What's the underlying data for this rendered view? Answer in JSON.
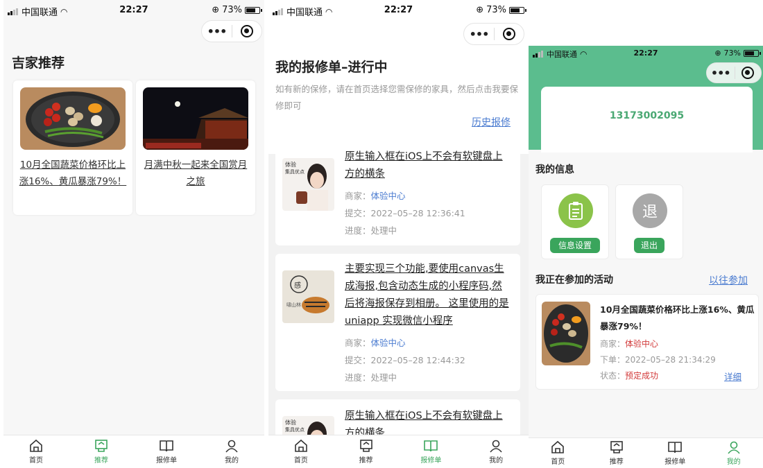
{
  "status": {
    "carrier": "中国联通",
    "time": "22:27",
    "battery": "73%"
  },
  "tabs": [
    {
      "label": "首页",
      "icon": "home-icon"
    },
    {
      "label": "推荐",
      "icon": "recommend-icon"
    },
    {
      "label": "报修单",
      "icon": "book-icon"
    },
    {
      "label": "我的",
      "icon": "user-icon"
    }
  ],
  "colors": {
    "accent": "#3aa55c",
    "link": "#4a7bd0",
    "header": "#5bbd8e",
    "danger": "#d23a3a"
  },
  "page1": {
    "title": "吉家推荐",
    "cards": [
      {
        "title": "10月全国蔬菜价格环比上涨16%、黄瓜暴涨79%！"
      },
      {
        "title": "月满中秋一起来全国赏月之旅"
      }
    ]
  },
  "page2": {
    "title": "我的报修单–进行中",
    "hint": "如有新的保修，请在首页选择您需保修的家具，然后点击我要保修即可",
    "history_link": "历史报修",
    "orders": [
      {
        "title": "原生输入框在iOS上不会有软键盘上方的横条",
        "merchant_label": "商家：",
        "merchant": "体验中心",
        "submit_label": "提交：",
        "submit": "2022–05–28 12:36:41",
        "progress_label": "进度：",
        "progress": "处理中"
      },
      {
        "title": "主要实现三个功能,要使用canvas生成海报,包含动态生成的小程序码,然后将海报保存到相册。 这里使用的是uniapp 实现微信小程序",
        "merchant_label": "商家：",
        "merchant": "体验中心",
        "submit_label": "提交：",
        "submit": "2022–05–28 12:44:32",
        "progress_label": "进度：",
        "progress": "处理中"
      },
      {
        "title": "原生输入框在iOS上不会有软键盘上方的横条"
      }
    ]
  },
  "page3": {
    "phone": "13173002095",
    "my_info": "我的信息",
    "info_settings": "信息设置",
    "logout_glyph": "退",
    "logout": "退出",
    "activities_title": "我正在参加的活动",
    "past_link": "以往参加",
    "activity": {
      "title": "10月全国蔬菜价格环比上涨16%、黄瓜暴涨79%！",
      "merchant_label": "商家：",
      "merchant": "体验中心",
      "order_label": "下单：",
      "order_time": "2022–05–28 21:34:29",
      "status_label": "状态：",
      "status": "预定成功",
      "detail": "详细"
    }
  }
}
